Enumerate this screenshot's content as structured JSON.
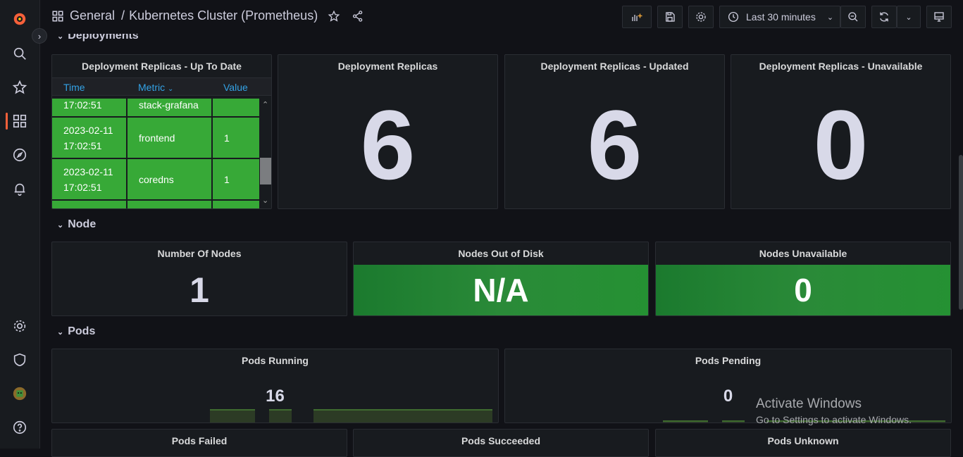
{
  "header": {
    "breadcrumb_folder": "General",
    "breadcrumb_sep": "/",
    "dashboard_title": "Kubernetes Cluster (Prometheus)",
    "time_range": "Last 30 minutes"
  },
  "rows": {
    "deployments": "Deployments",
    "node": "Node",
    "pods": "Pods"
  },
  "deployment_table": {
    "title": "Deployment Replicas - Up To Date",
    "columns": [
      "Time",
      "Metric",
      "Value"
    ],
    "rows": [
      {
        "time": "17:02:51",
        "metric": "stack-grafana",
        "value": ""
      },
      {
        "time_date": "2023-02-11",
        "time": "17:02:51",
        "metric": "frontend",
        "value": "1"
      },
      {
        "time_date": "2023-02-11",
        "time": "17:02:51",
        "metric": "coredns",
        "value": "1"
      }
    ],
    "cell_color": "#37a937"
  },
  "stats": {
    "deployment_replicas": {
      "title": "Deployment Replicas",
      "value": "6"
    },
    "deployment_replicas_updated": {
      "title": "Deployment Replicas - Updated",
      "value": "6"
    },
    "deployment_replicas_unavailable": {
      "title": "Deployment Replicas - Unavailable",
      "value": "0"
    },
    "number_of_nodes": {
      "title": "Number Of Nodes",
      "value": "1"
    },
    "nodes_out_of_disk": {
      "title": "Nodes Out of Disk",
      "value": "N/A"
    },
    "nodes_unavailable": {
      "title": "Nodes Unavailable",
      "value": "0"
    },
    "pods_running": {
      "title": "Pods Running",
      "value": "16"
    },
    "pods_pending": {
      "title": "Pods Pending",
      "value": "0"
    },
    "pods_failed": {
      "title": "Pods Failed"
    },
    "pods_succeeded": {
      "title": "Pods Succeeded"
    },
    "pods_unknown": {
      "title": "Pods Unknown"
    }
  },
  "overlay": {
    "line1": "Activate Windows",
    "line2": "Go to Settings to activate Windows."
  },
  "colors": {
    "accent": "#f5603a",
    "ok_green": "#37a937",
    "link_blue": "#33a2e5"
  }
}
